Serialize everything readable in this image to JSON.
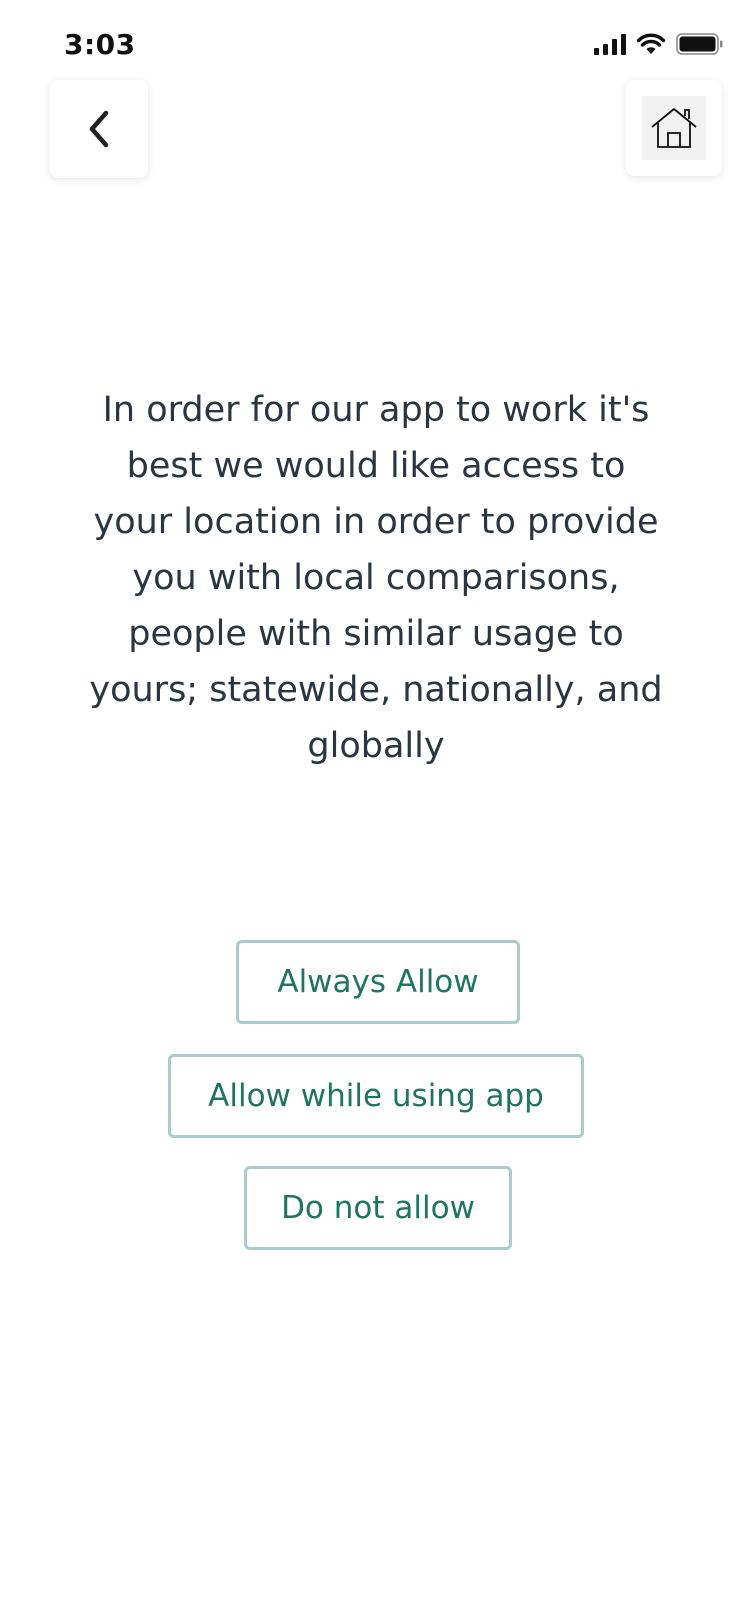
{
  "status_bar": {
    "time": "3:03",
    "icons": [
      "signal-icon",
      "wifi-icon",
      "battery-icon"
    ]
  },
  "nav": {
    "back_icon": "chevron-left-icon",
    "home_icon": "home-icon"
  },
  "message": "In order for our app to work it's best we would like access to your location in order to provide you with local comparisons, people with similar usage to yours; statewide, nationally, and globally",
  "buttons": {
    "always_allow": "Always Allow",
    "allow_while_using": "Allow while using app",
    "do_not_allow": "Do not allow"
  },
  "colors": {
    "button_text": "#1f7462",
    "button_border": "#a9cccb",
    "message_text": "#2b3441"
  }
}
